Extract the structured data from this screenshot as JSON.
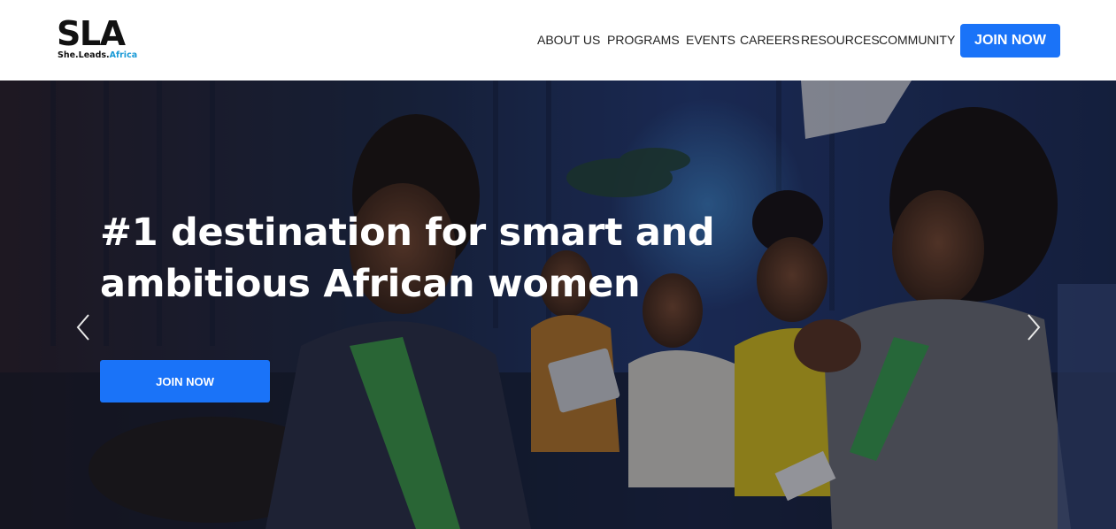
{
  "header": {
    "logo": {
      "main": "SLA",
      "sub_part1": "She.Leads.",
      "sub_part2": "Africa"
    },
    "nav": [
      {
        "label": "ABOUT US"
      },
      {
        "label": "PROGRAMS"
      },
      {
        "label": "EVENTS"
      },
      {
        "label": "CAREERS"
      },
      {
        "label": "RESOURCES"
      },
      {
        "label": "COMMUNITY"
      }
    ],
    "cta_label": "JOIN NOW"
  },
  "hero": {
    "title": "#1 destination for smart and ambitious African women",
    "cta_label": "JOIN NOW",
    "prev_icon": "chevron-left-icon",
    "next_icon": "chevron-right-icon"
  },
  "colors": {
    "accent": "#1a73f8",
    "logo_accent": "#1a9ad6",
    "nav_text": "#222222",
    "hero_text": "#ffffff"
  }
}
